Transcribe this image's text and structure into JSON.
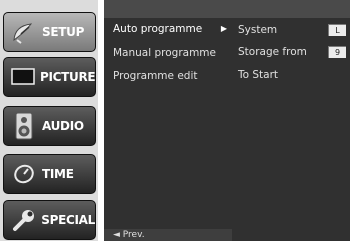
{
  "sidebar": {
    "items": [
      {
        "label": "SETUP",
        "icon": "satellite-dish-icon",
        "active": true
      },
      {
        "label": "PICTURE",
        "icon": "tv-screen-icon",
        "active": false
      },
      {
        "label": "AUDIO",
        "icon": "speaker-icon",
        "active": false
      },
      {
        "label": "TIME",
        "icon": "clock-icon",
        "active": false
      },
      {
        "label": "SPECIAL",
        "icon": "wrench-icon",
        "active": false
      }
    ]
  },
  "menu": {
    "items": [
      {
        "label": "Auto programme",
        "arrow": "▶"
      },
      {
        "label": "Manual programme"
      },
      {
        "label": "Programme edit"
      }
    ],
    "back_label": "◄ Prev."
  },
  "submenu": {
    "items": [
      {
        "label": "System",
        "value": "L"
      },
      {
        "label": "Storage from",
        "value": "9"
      },
      {
        "label": "To Start"
      }
    ]
  }
}
